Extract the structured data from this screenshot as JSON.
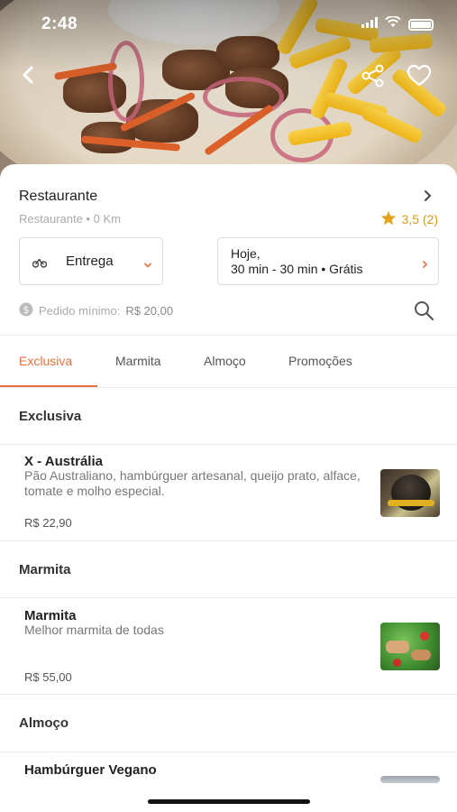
{
  "status_bar": {
    "time": "2:48"
  },
  "hero": {
    "back_icon": "chevron-left-icon",
    "share_icon": "share-icon",
    "favorite_icon": "heart-outline-icon"
  },
  "restaurant": {
    "name": "Restaurante",
    "subtitle": "Restaurante • 0 Km",
    "rating": "3,5 (2)"
  },
  "delivery": {
    "mode_label": "Entrega",
    "when_line1": "Hoje,",
    "when_line2": "30 min - 30 min • Grátis"
  },
  "min_order": {
    "label": "Pedido mínimo:",
    "value": "R$ 20,00"
  },
  "tabs": [
    {
      "label": "Exclusiva",
      "active": true
    },
    {
      "label": "Marmita",
      "active": false
    },
    {
      "label": "Almoço",
      "active": false
    },
    {
      "label": "Promoções",
      "active": false
    }
  ],
  "sections": [
    {
      "title": "Exclusiva",
      "items": [
        {
          "title": "X - Austrália",
          "desc": "Pão Australiano, hambúrguer artesanal, queijo prato, alface, tomate e molho especial.",
          "price": "R$ 22,90"
        }
      ]
    },
    {
      "title": "Marmita",
      "items": [
        {
          "title": "Marmita",
          "desc": "Melhor marmita de todas",
          "price": "R$ 55,00"
        }
      ]
    },
    {
      "title": "Almoço",
      "items": [
        {
          "title": "Hambúrguer Vegano"
        }
      ]
    }
  ],
  "colors": {
    "accent": "#e8703c",
    "star": "#e5a21f"
  }
}
